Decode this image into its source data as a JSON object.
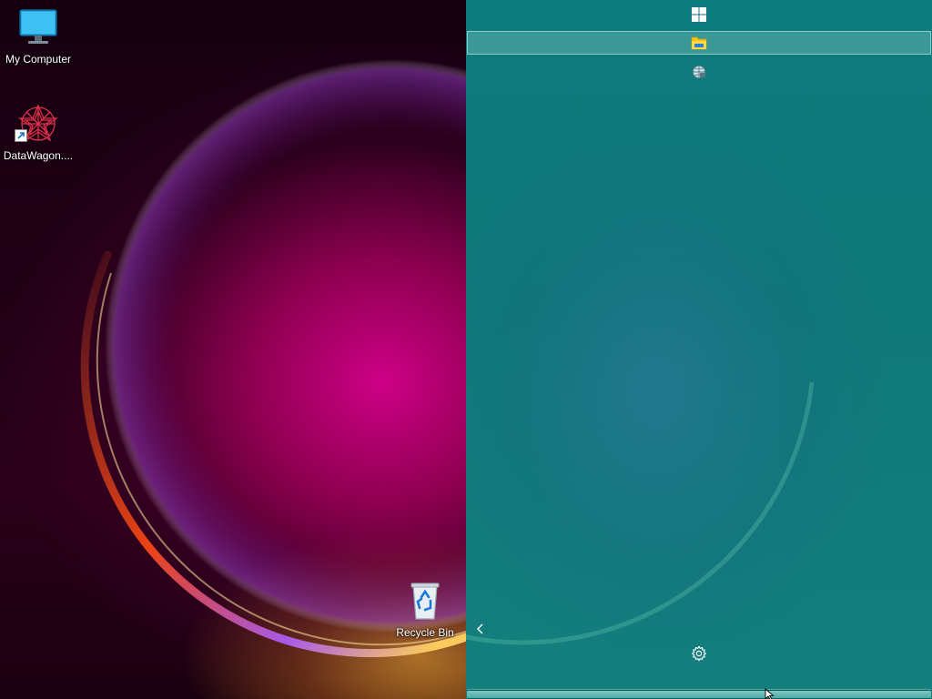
{
  "desktop": {
    "icons": [
      {
        "label": "My Computer",
        "icon": "computer-monitor-icon"
      },
      {
        "label": "DataWagon....",
        "icon": "datawagon-app-icon",
        "shortcut": true
      },
      {
        "label": "Recycle Bin",
        "icon": "recycle-bin-icon"
      }
    ]
  },
  "panel": {
    "items": [
      {
        "icon": "windows-logo-icon"
      },
      {
        "icon": "folder-icon",
        "selected": true
      },
      {
        "icon": "network-globe-icon"
      }
    ],
    "collapse_icon": "chevron-left-icon",
    "settings_icon": "gear-icon",
    "scrollbar": {
      "position": 1.0
    }
  },
  "colors": {
    "panel_bg": "#0f7878",
    "selection": "#7fc9c4",
    "wallpaper_magenta": "#d7008c"
  }
}
